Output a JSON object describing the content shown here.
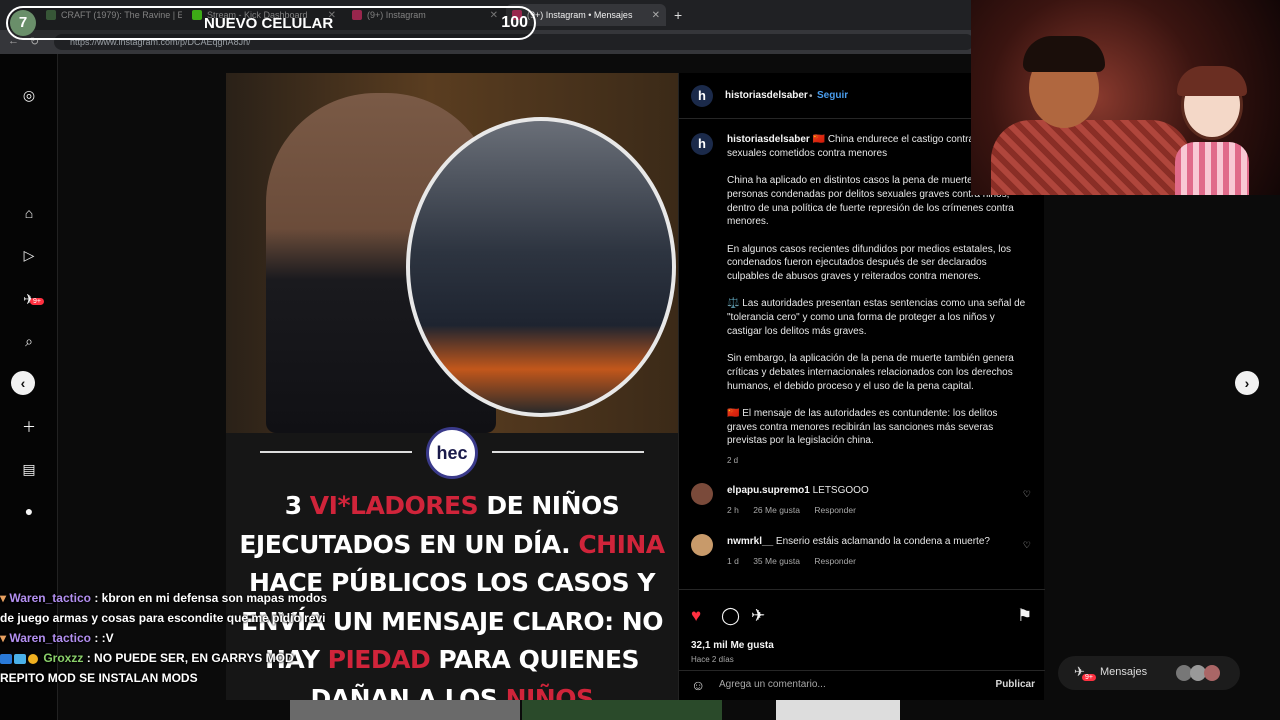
{
  "browser": {
    "tabs": [
      {
        "label": "CRAFT (1979): The Ravine | Episo",
        "fav": "#4a7a4a"
      },
      {
        "label": "Stream - Kick Dashboard",
        "fav": "#53fc18"
      },
      {
        "label": "(9+) Instagram",
        "fav": "#e1306c"
      },
      {
        "label": "(9+) Instagram • Mensajes",
        "fav": "#e1306c"
      }
    ],
    "new_tab_icon": "+",
    "url": "https://www.instagram.com/p/DCAEqgnA8Jh/"
  },
  "overlay": {
    "counter_left": "7",
    "title": "NUEVO CELULAR",
    "counter_right": "100"
  },
  "post": {
    "logo_text": "hec",
    "headline_parts": [
      {
        "text": "3 ",
        "red": false
      },
      {
        "text": "VI*LADORES",
        "red": true
      },
      {
        "text": " DE NIÑOS EJECUTADOS EN UN DÍA. ",
        "red": false
      },
      {
        "text": "CHINA",
        "red": true
      },
      {
        "text": " HACE PÚBLICOS LOS CASOS Y ENVÍA UN MENSAJE CLARO: NO HAY ",
        "red": false
      },
      {
        "text": "PIEDAD",
        "red": true
      },
      {
        "text": " PARA QUIENES DAÑAN A LOS ",
        "red": false
      },
      {
        "text": "NIÑOS",
        "red": true
      }
    ]
  },
  "panel": {
    "author": "historiasdelsaber",
    "avatar_letter": "h",
    "follow_sep": "•",
    "follow": "Seguir",
    "caption_author": "historiasdelsaber",
    "caption_first": "🇨🇳 China endurece el castigo contra delitos sexuales cometidos contra menores",
    "caption_paragraphs": [
      "China ha aplicado en distintos casos la pena de muerte contra personas condenadas por delitos sexuales graves contra niños, dentro de una política de fuerte represión de los crímenes contra menores.",
      "En algunos casos recientes difundidos por medios estatales, los condenados fueron ejecutados después de ser declarados culpables de abusos graves y reiterados contra menores.",
      "⚖️ Las autoridades presentan estas sentencias como una señal de \"tolerancia cero\" y como una forma de proteger a los niños y castigar los delitos más graves.",
      "Sin embargo, la aplicación de la pena de muerte también genera críticas y debates internacionales relacionados con los derechos humanos, el debido proceso y el uso de la pena capital.",
      "🇨🇳 El mensaje de las autoridades es contundente: los delitos graves contra menores recibirán las sanciones más severas previstas por la legislación china."
    ],
    "caption_time": "2 d",
    "comments": [
      {
        "user": "elpapu.supremo1",
        "text": "LETSGOOO",
        "time": "2 h",
        "likes": "26 Me gusta",
        "reply": "Responder",
        "avatar_color": "#7a4a3a"
      },
      {
        "user": "nwmrkl__",
        "text": "Enserio estáis aclamando la condena a muerte?",
        "time": "1 d",
        "likes": "35 Me gusta",
        "reply": "Responder",
        "avatar_color": "#c89a6a"
      }
    ],
    "likes": "32,1 mil Me gusta",
    "ago": "Hace 2 días",
    "add_comment_placeholder": "Agrega un comentario...",
    "publish": "Publicar"
  },
  "chat": [
    {
      "user": "Waren_tactico",
      "text": ": kbron en mi defensa son mapas modos de juego armas y cosas para escondite que me pidio revi"
    },
    {
      "user": "Waren_tactico",
      "text": ": :V"
    },
    {
      "user": "Groxzz",
      "text": ": NO PUEDE SER, EN GARRYS MOD REPITO MOD SE INSTALAN MODS"
    }
  ],
  "messages_pill": {
    "label": "Mensajes",
    "badge": "9+"
  },
  "sidebar": {
    "badge": "9+"
  }
}
